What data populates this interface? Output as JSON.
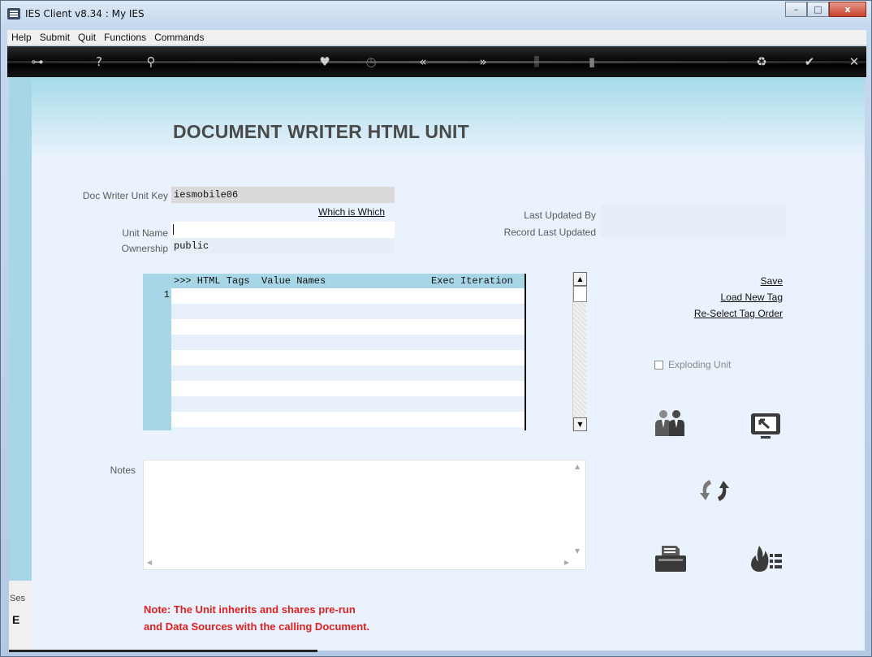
{
  "window": {
    "title": "IES Client v8.34 : My IES",
    "min_label": "–",
    "max_label": "□",
    "close_label": "x"
  },
  "menu": [
    "Help",
    "Submit",
    "Quit",
    "Functions",
    "Commands"
  ],
  "toolbar_icons": [
    "key-icon",
    "help-icon",
    "search-icon",
    "heart-icon",
    "clock-icon",
    "back-icon",
    "forward-icon",
    "tools-icon",
    "page-icon",
    "recycle-icon",
    "check-icon",
    "close-icon"
  ],
  "toolbar_glyphs": {
    "key": "⊶",
    "help": "?",
    "search": "⚲",
    "heart": "♥",
    "clock": "◷",
    "back": "«",
    "forward": "»",
    "tools": "⫼",
    "page": "▮",
    "recycle": "♻",
    "check": "✔",
    "close": "✕"
  },
  "page": {
    "title": "DOCUMENT WRITER HTML UNIT"
  },
  "form": {
    "unit_key_label": "Doc Writer Unit Key",
    "unit_key_value": "iesmobile06",
    "which_is_which": "Which is Which",
    "unit_name_label": "Unit Name",
    "unit_name_value": "",
    "ownership_label": "Ownership",
    "ownership_value": "public",
    "last_updated_by_label": "Last Updated By",
    "last_updated_by_value": "",
    "record_last_updated_label": "Record Last Updated",
    "record_last_updated_value": ""
  },
  "grid": {
    "header_col1": ">>> HTML Tags",
    "header_col2": "Value Names",
    "header_col3": "Exec Iteration",
    "row_number": "1"
  },
  "scroll": {
    "up": "▲",
    "down": "▼"
  },
  "actions": {
    "save": "Save",
    "load_new_tag": "Load New Tag",
    "reselect_tag_order": "Re-Select Tag Order"
  },
  "exploding_unit_label": "Exploding Unit",
  "notes_label": "Notes",
  "notes_scroll": {
    "up": "▲",
    "down": "▼",
    "left": "◀",
    "right": "▶"
  },
  "note_line1": "Note: The Unit inherits and shares pre-run",
  "note_line2": "and Data Sources with the calling Document.",
  "session": {
    "label": "Ses",
    "glyph": "E"
  },
  "colors": {
    "accent_strip": "#a7d6e6",
    "note_red": "#e02020",
    "toolbar_bg": "#000000"
  }
}
